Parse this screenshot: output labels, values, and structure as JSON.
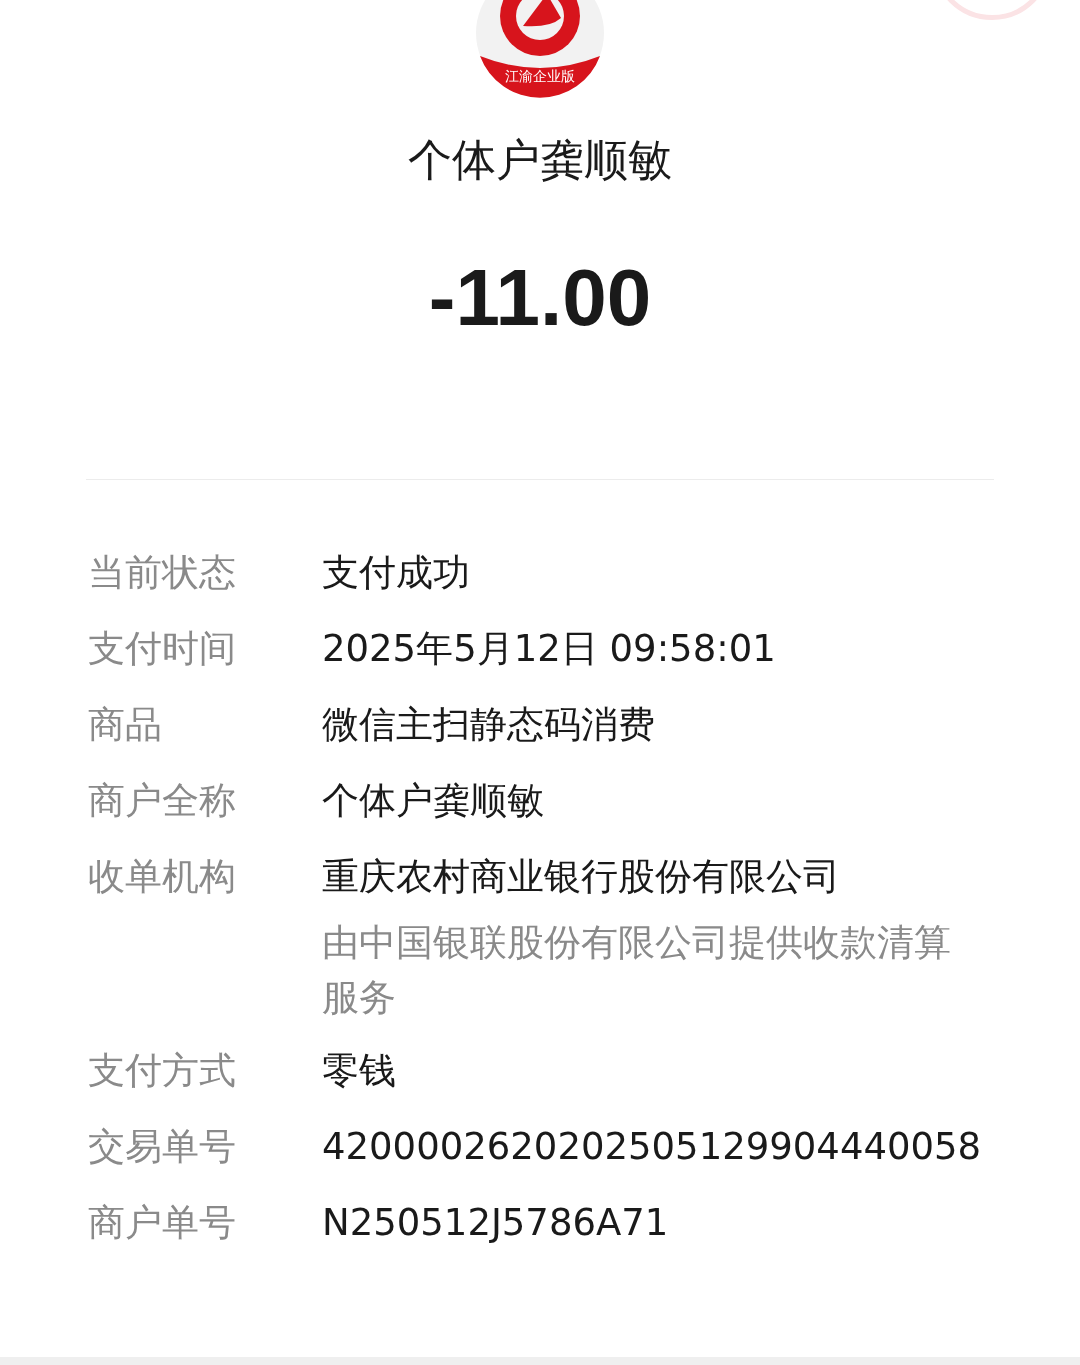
{
  "logo": {
    "text": "江渝企业版"
  },
  "merchant_title": "个体户龚顺敏",
  "amount": "-11.00",
  "details": [
    {
      "label": "当前状态",
      "value": "支付成功"
    },
    {
      "label": "支付时间",
      "value": "2025年5月12日 09:58:01"
    },
    {
      "label": "商品",
      "value": "微信主扫静态码消费"
    },
    {
      "label": "商户全称",
      "value": "个体户龚顺敏"
    },
    {
      "label": "收单机构",
      "value": "重庆农村商业银行股份有限公司",
      "note": "由中国银联股份有限公司提供收款清算服务"
    },
    {
      "label": "支付方式",
      "value": "零钱"
    },
    {
      "label": "交易单号",
      "value": "4200002620202505129904440058"
    },
    {
      "label": "商户单号",
      "value": "N250512J5786A71"
    }
  ]
}
